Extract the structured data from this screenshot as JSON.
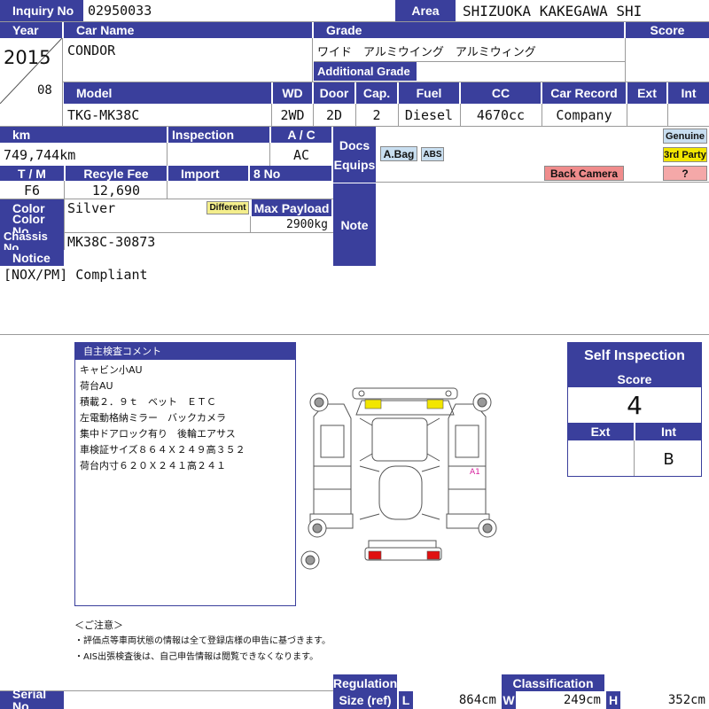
{
  "header": {
    "inquiry_label": "Inquiry No",
    "inquiry_value": "02950033",
    "area_label": "Area",
    "area_value": "SHIZUOKA KAKEGAWA SHI",
    "year_label": "Year",
    "car_name_label": "Car Name",
    "grade_label": "Grade",
    "score_label": "Score",
    "year": "2015",
    "month": "08",
    "car_name": "CONDOR",
    "grade": "ワイド　アルミウイング　アルミウィング",
    "additional_grade_label": "Additional Grade"
  },
  "specs": {
    "labels": {
      "model": "Model",
      "wd": "WD",
      "door": "Door",
      "cap": "Cap.",
      "fuel": "Fuel",
      "cc": "CC",
      "car_record": "Car Record",
      "ext": "Ext",
      "int": "Int"
    },
    "model": "TKG-MK38C",
    "wd": "2WD",
    "door": "2D",
    "cap": "2",
    "fuel": "Diesel",
    "cc": "4670cc",
    "car_record": "Company"
  },
  "details": {
    "km_label": "km",
    "km": "749,744km",
    "inspection_label": "Inspection",
    "ac_label": "A / C",
    "ac": "AC",
    "tm_label": "T / M",
    "tm": "F6",
    "recycle_label": "Recyle Fee",
    "recycle": "12,690",
    "import_label": "Import",
    "no8_label": "8 No",
    "color_label": "Color",
    "color": "Silver",
    "different_badge": "Different",
    "max_payload_label": "Max Payload",
    "max_payload": "2900kg",
    "color_no_label": "Color No",
    "chassis_label": "Chassis No",
    "chassis": "MK38C-30873",
    "docs_label": "Docs",
    "equips_label": "Equips",
    "note_label": "Note",
    "equips": [
      "A.Bag",
      "ABS"
    ],
    "back_camera": "Back Camera",
    "genuine": "Genuine",
    "third_party": "3rd Party",
    "unknown": "?",
    "notice_label": "Notice",
    "notice": "[NOX/PM] Compliant"
  },
  "comment": {
    "title": "自主検査コメント",
    "lines": [
      "キャビン小AU",
      "荷台AU",
      "積載２．９ｔ　ベット　ＥＴＣ",
      "左電動格納ミラー　バックカメラ",
      "集中ドアロック有り　後輪エアサス",
      "車検証サイズ８６４Ｘ２４９高３５２",
      "荷台内寸６２０Ｘ２４１高２４１"
    ],
    "caution_title": "＜ご注意＞",
    "caution_lines": [
      "・評価点等車両状態の情報は全て登録店様の申告に基づきます。",
      "・AIS出張検査後は、自己申告情報は閲覧できなくなります。"
    ]
  },
  "diagram": {
    "damage_mark": "A1",
    "yellow": "#f2e600",
    "red": "#e01010"
  },
  "self_inspection": {
    "title": "Self Inspection",
    "score_label": "Score",
    "score": "4",
    "ext_label": "Ext",
    "int_label": "Int",
    "ext": "",
    "int": "B"
  },
  "footer": {
    "serial_label": "Serial No",
    "regulation_label": "Regulation",
    "size_label": "Size (ref)",
    "classification_label": "Classification",
    "l_label": "L",
    "l": "864cm",
    "w_label": "W",
    "w": "249cm",
    "h_label": "H",
    "h": "352cm"
  },
  "colors": {
    "header": "#3a3f9c",
    "border": "#9a9a9a"
  }
}
